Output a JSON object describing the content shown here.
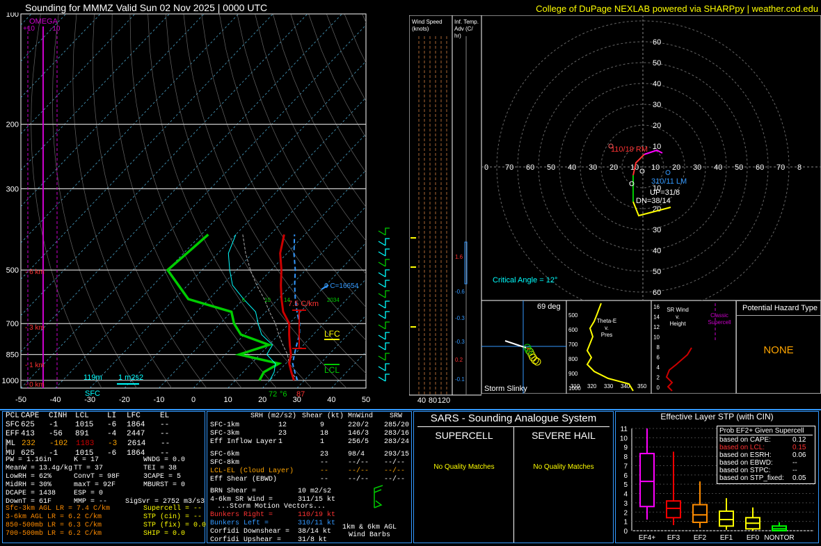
{
  "header": {
    "title": "Sounding for MMMZ Valid  Sun 02 Nov 2025 | 0000 UTC",
    "credit": "College of DuPage NEXLAB powered via SHARPpy | weather.cod.edu"
  },
  "colors": {
    "green": "#00cc00",
    "red": "#cc0000",
    "cyan": "#00ffff",
    "yellow": "#ffff00",
    "magenta": "#ff00ff",
    "orange": "#ffa500",
    "blue": "#3399ff"
  },
  "skewt": {
    "pressure_labels": [
      "100",
      "200",
      "300",
      "500",
      "700",
      "850",
      "1000"
    ],
    "temp_labels": [
      "-50",
      "-40",
      "-30",
      "-20",
      "-10",
      "0",
      "10",
      "20",
      "30",
      "40",
      "50"
    ],
    "omega_label": "OMEGA",
    "omega_ticks": [
      "+10",
      "-10"
    ],
    "height_labels": [
      "6 km",
      "3 km",
      "1 km",
      "0 km"
    ],
    "lapse_label": "7.5 C/km",
    "lfc_label": "LFC",
    "lcl_label": "LCL",
    "zero_c_label": "0 C=16654",
    "sfc_label": "SFC",
    "sfc_temp": "72",
    "sfc_dew": "87",
    "sfc_td_label": "°6",
    "inflow_height": "119m",
    "inflow_srh": "1 m2s2",
    "mixing_labels": [
      "6",
      "10",
      "14",
      "2034"
    ]
  },
  "chart_data": {
    "type": "line",
    "title": "Sounding for MMMZ Valid  Sun 02 Nov 2025 | 0000 UTC",
    "xlabel": "",
    "ylabel": "",
    "log_pressure_axis": true,
    "xlim": [
      -50,
      50
    ],
    "ylim": [
      1050,
      100
    ],
    "series": [
      {
        "name": "",
        "color": "#cc0000",
        "points": [
          [
            27,
            1000
          ],
          [
            24,
            950
          ],
          [
            21,
            900
          ],
          [
            19,
            850
          ],
          [
            16,
            800
          ],
          [
            13,
            750
          ],
          [
            10,
            700
          ],
          [
            5,
            650
          ],
          [
            1,
            600
          ],
          [
            -3,
            550
          ],
          [
            -7,
            500
          ],
          [
            -12,
            450
          ],
          [
            -16,
            400
          ]
        ]
      },
      {
        "name": "",
        "color": "#00cc00",
        "points": [
          [
            17,
            1000
          ],
          [
            16,
            950
          ],
          [
            18,
            900
          ],
          [
            4,
            850
          ],
          [
            10,
            800
          ],
          [
            -1,
            750
          ],
          [
            -6,
            700
          ],
          [
            -10,
            650
          ],
          [
            -26,
            600
          ],
          [
            -40,
            500
          ],
          [
            -39,
            450
          ],
          [
            -38,
            400
          ]
        ]
      },
      {
        "name": "",
        "color": "#3399ff",
        "points": [
          [
            28,
            1000
          ],
          [
            25,
            950
          ],
          [
            22,
            900
          ],
          [
            20,
            850
          ],
          [
            18,
            800
          ],
          [
            16,
            750
          ],
          [
            13,
            700
          ],
          [
            9,
            650
          ],
          [
            5,
            600
          ],
          [
            1,
            550
          ],
          [
            -3,
            500
          ],
          [
            -8,
            450
          ],
          [
            -13,
            400
          ]
        ]
      }
    ]
  },
  "wind": {
    "speed_title": "Wind Speed\n(knots)",
    "speed_ticks": [
      "40",
      "80",
      "120"
    ],
    "adv_title": "Inf. Temp.\nAdv (C/\nhr)",
    "adv_values": [
      "1.6",
      "-0.6",
      "-0.3",
      "-0.3",
      "0.2",
      "-0.1"
    ]
  },
  "hodograph": {
    "rings": [
      "10",
      "20",
      "30",
      "40",
      "50",
      "60"
    ],
    "xticks": [
      "0",
      "70",
      "60",
      "50",
      "40",
      "30",
      "20",
      "10",
      "10",
      "20",
      "30",
      "40",
      "50",
      "60",
      "70",
      "8"
    ],
    "rm_label": "110/19 RM",
    "lm_label": "310/11 LM",
    "up_label": "UP=31/8",
    "dn_label": "DN=38/14",
    "crit_angle": "Critical Angle = 12°"
  },
  "slinky": {
    "angle": "69 deg",
    "title": "Storm Slinky"
  },
  "theta": {
    "title": "Theta-E\nv.\nPres",
    "yticks": [
      "500",
      "600",
      "700",
      "800",
      "900",
      "1000"
    ],
    "xticks": [
      "310",
      "320",
      "330",
      "340",
      "350"
    ]
  },
  "srwind": {
    "title": "SR Wind\nv.\nHeight",
    "note": "Classic\nSupercell",
    "yticks": [
      "16",
      "14",
      "12",
      "10",
      "8",
      "6",
      "4",
      "2",
      "0"
    ]
  },
  "hazard": {
    "title": "Potential Hazard Type",
    "value": "NONE"
  },
  "parcels": {
    "headers": [
      "PCL",
      "CAPE",
      "CINH",
      "LCL",
      "LI",
      "LFC",
      "EL"
    ],
    "rows": [
      [
        "SFC",
        "625",
        "-1",
        "1015",
        "-6",
        "1864",
        "--"
      ],
      [
        "EFF",
        "413",
        "-56",
        "891",
        "-4",
        "2447",
        "--"
      ],
      [
        "ML",
        "232",
        "-102",
        "1183",
        "-3",
        "2614",
        "--"
      ],
      [
        "MU",
        "625",
        "-1",
        "1015",
        "-6",
        "1864",
        "--"
      ]
    ]
  },
  "indices": {
    "col1": [
      "PW = 1.16in",
      "MeanW = 13.4g/kg",
      "LowRH = 62%",
      "MidRH = 30%",
      "DCAPE = 1438",
      "DownT = 61F"
    ],
    "col2": [
      "K = 17",
      "TT = 37",
      "ConvT = 98F",
      "maxT = 92F",
      "ESP = 0",
      "MMP = --"
    ],
    "col3": [
      "WNDG = 0.0",
      "TEI = 38",
      "3CAPE = 5",
      "MBURST = 0",
      "",
      ""
    ],
    "sigsvr": "SigSvr = 2752 m3/s3"
  },
  "lapse": [
    "Sfc-3km AGL LR = 7.4 C/km",
    "3-6km AGL LR = 6.2 C/km",
    "850-500mb LR = 6.3 C/km",
    "700-500mb LR = 6.2 C/km"
  ],
  "composite": [
    "Supercell = --",
    "STP (cin) = --",
    "STP (fix) = 0.0",
    "SHIP = 0.0"
  ],
  "kinematics": {
    "headers": [
      "SRH (m2/s2)",
      "Shear (kt)",
      "MnWind",
      "SRW"
    ],
    "rows": [
      [
        "SFC-1km",
        "12",
        "9",
        "220/2",
        "285/20"
      ],
      [
        "SFC-3km",
        "23",
        "18",
        "146/3",
        "283/16"
      ],
      [
        "Eff Inflow Layer",
        "1",
        "1",
        "256/5",
        "283/24"
      ],
      [
        "",
        "",
        "",
        "",
        ""
      ],
      [
        "SFC-6km",
        "23",
        "98/4",
        "293/15",
        ""
      ],
      [
        "SFC-8km",
        "--",
        "--/--",
        "--/--",
        ""
      ],
      [
        "LCL-EL (Cloud Layer)",
        "--",
        "--/--",
        "--/--",
        ""
      ],
      [
        "Eff Shear (EBWD)",
        "--",
        "--/--",
        "--/--",
        ""
      ]
    ],
    "brn": "BRN Shear =",
    "brn_val": "10 m2/s2",
    "srwind46": "4-6km SR Wind =",
    "srwind46_val": "311/15 kt",
    "storm_title": "...Storm Motion Vectors...",
    "br": "Bunkers Right =",
    "br_val": "110/19 kt",
    "bl": "Bunkers Left =",
    "bl_val": "310/11 kt",
    "cd": "Corfidi Downshear =",
    "cd_val": "38/14 kt",
    "cu": "Corfidi Upshear =",
    "cu_val": "31/8 kt",
    "barb_label": "1km & 6km AGL\nWind Barbs"
  },
  "sars": {
    "title": "SARS - Sounding Analogue System",
    "supercell": "SUPERCELL",
    "hail": "SEVERE HAIL",
    "sup_result": "No Quality Matches",
    "hail_result": "No Quality Matches"
  },
  "stp": {
    "title": "Effective Layer STP (with CIN)",
    "yticks": [
      "0",
      "1",
      "2",
      "3",
      "4",
      "5",
      "6",
      "7",
      "8",
      "9",
      "10",
      "11"
    ],
    "cats": [
      "EF4+",
      "EF3",
      "EF2",
      "EF1",
      "EF0",
      "NONTOR"
    ],
    "box_colors": [
      "#ff00ff",
      "#ff0000",
      "#ff8c00",
      "#ffff00",
      "#ffff00",
      "#00ff00"
    ],
    "boxes": [
      {
        "lo": 1.2,
        "q1": 2.6,
        "med": 5.3,
        "q3": 8.3,
        "hi": 11
      },
      {
        "lo": 0.6,
        "q1": 1.4,
        "med": 2.4,
        "q3": 3.2,
        "hi": 8.5
      },
      {
        "lo": 0.3,
        "q1": 0.9,
        "med": 1.7,
        "q3": 2.8,
        "hi": 5.3
      },
      {
        "lo": 0.1,
        "q1": 0.5,
        "med": 1.2,
        "q3": 2.1,
        "hi": 3.5
      },
      {
        "lo": 0,
        "q1": 0.2,
        "med": 0.8,
        "q3": 1.4,
        "hi": 2.5
      },
      {
        "lo": 0,
        "q1": 0,
        "med": 0.2,
        "q3": 0.5,
        "hi": 0.9
      }
    ],
    "prob_title": "Prob EF2+ Given Supercell",
    "prob_rows": [
      [
        "based on CAPE:",
        "0.12"
      ],
      [
        "based on LCL:",
        "0.15"
      ],
      [
        "based on ESRH:",
        "0.06"
      ],
      [
        "based on EBWD:",
        "--"
      ],
      [
        "based on STPC:",
        "--"
      ],
      [
        "based on STP_fixed:",
        "0.05"
      ]
    ]
  }
}
